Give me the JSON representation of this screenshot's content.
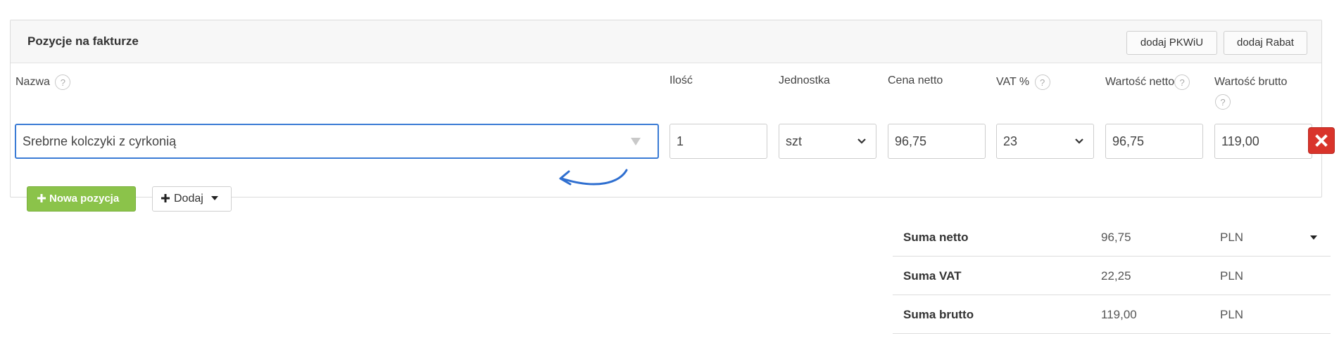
{
  "panel": {
    "title": "Pozycje na fakturze",
    "btn_pkwiu": "dodaj PKWiU",
    "btn_rabat": "dodaj Rabat"
  },
  "columns": {
    "name": "Nazwa",
    "qty": "Ilość",
    "unit": "Jednostka",
    "net_price": "Cena netto",
    "vat": "VAT %",
    "net_value": "Wartość netto",
    "gross_value": "Wartość brutto",
    "help": "?"
  },
  "row": {
    "name": "Srebrne kolczyki z cyrkonią",
    "qty": "1",
    "unit": "szt",
    "net_price": "96,75",
    "vat": "23",
    "net_value": "96,75",
    "gross_value": "119,00"
  },
  "buttons": {
    "new_item": "Nowa pozycja",
    "add": "Dodaj"
  },
  "summary": [
    {
      "label": "Suma netto",
      "value": "96,75",
      "currency": "PLN"
    },
    {
      "label": "Suma VAT",
      "value": "22,25",
      "currency": "PLN"
    },
    {
      "label": "Suma brutto",
      "value": "119,00",
      "currency": "PLN"
    }
  ],
  "colors": {
    "accent_blue": "#3a7bd5",
    "delete_red": "#d9342b",
    "green_button": "#8bc34a"
  },
  "icons": [
    "help-icon",
    "dropdown-caret-icon",
    "chevron-down-icon",
    "close-icon",
    "plus-icon",
    "caret-down-icon",
    "curved-arrow-icon"
  ]
}
